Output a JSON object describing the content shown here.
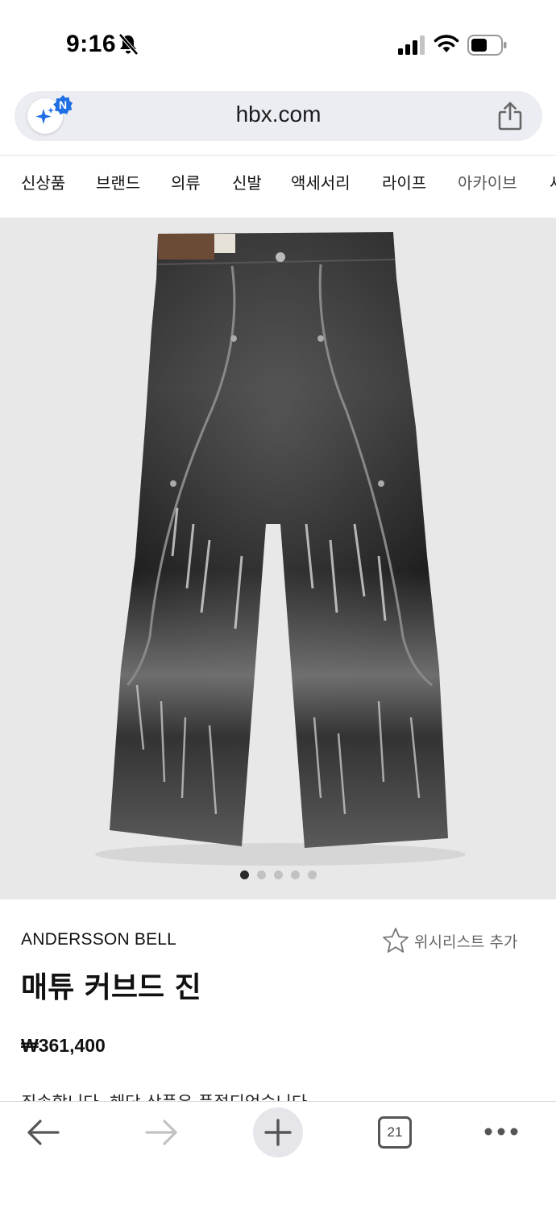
{
  "status_bar": {
    "time": "9:16"
  },
  "browser": {
    "url": "hbx.com",
    "ai_badge": "N",
    "tab_count": "21"
  },
  "categories": [
    "신상품",
    "브랜드",
    "의류",
    "신발",
    "액세서리",
    "라이프",
    "아카이브",
    "세"
  ],
  "gallery": {
    "total_images": 5,
    "active_index": 0
  },
  "product": {
    "brand": "ANDERSSON BELL",
    "wishlist_label": "위시리스트 추가",
    "title": "매튜 커브드 진",
    "price": "₩361,400",
    "notice": "죄송합니다. 해당 상품은 품절되었습니다"
  },
  "colors": {
    "accent_blue": "#1f6fe5",
    "background": "#ffffff",
    "image_background": "#e8e8e8"
  },
  "icons": {
    "status": [
      "bell-off-icon",
      "signal-icon",
      "wifi-icon",
      "battery-icon"
    ],
    "toolbar": [
      "back-arrow-icon",
      "forward-arrow-icon",
      "plus-icon",
      "tabs-icon",
      "more-icon"
    ]
  }
}
